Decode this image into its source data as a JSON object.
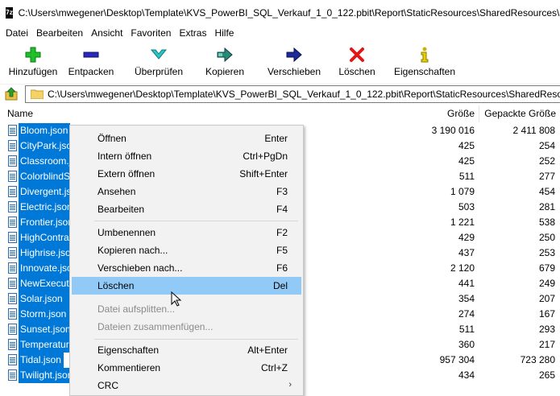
{
  "title": {
    "icon_text": "7z",
    "path": "C:\\Users\\mwegener\\Desktop\\Template\\KVS_PowerBI_SQL_Verkauf_1_0_122.pbit\\Report\\StaticResources\\SharedResources\\Buil"
  },
  "menu": [
    "Datei",
    "Bearbeiten",
    "Ansicht",
    "Favoriten",
    "Extras",
    "Hilfe"
  ],
  "toolbar": {
    "add": "Hinzufügen",
    "extract": "Entpacken",
    "test": "Überprüfen",
    "copy": "Kopieren",
    "move": "Verschieben",
    "delete": "Löschen",
    "info": "Eigenschaften"
  },
  "address": {
    "path": "C:\\Users\\mwegener\\Desktop\\Template\\KVS_PowerBI_SQL_Verkauf_1_0_122.pbit\\Report\\StaticResources\\SharedResources"
  },
  "columns": {
    "name": "Name",
    "size": "Größe",
    "packed": "Gepackte Größe"
  },
  "files": [
    {
      "name": "Bloom.json",
      "size": "3 190 016",
      "packed": "2 411 808"
    },
    {
      "name": "CityPark.json",
      "size": "425",
      "packed": "254"
    },
    {
      "name": "Classroom.json",
      "size": "425",
      "packed": "252"
    },
    {
      "name": "ColorblindSafe",
      "size": "511",
      "packed": "277"
    },
    {
      "name": "Divergent.json",
      "size": "1 079",
      "packed": "454"
    },
    {
      "name": "Electric.json",
      "size": "503",
      "packed": "281"
    },
    {
      "name": "Frontier.json",
      "size": "1 221",
      "packed": "538"
    },
    {
      "name": "HighContrast",
      "size": "429",
      "packed": "250"
    },
    {
      "name": "Highrise.json",
      "size": "437",
      "packed": "253"
    },
    {
      "name": "Innovate.json",
      "size": "2 120",
      "packed": "679"
    },
    {
      "name": "NewExecutive",
      "size": "441",
      "packed": "249"
    },
    {
      "name": "Solar.json",
      "size": "354",
      "packed": "207"
    },
    {
      "name": "Storm.json",
      "size": "274",
      "packed": "167"
    },
    {
      "name": "Sunset.json",
      "size": "511",
      "packed": "293"
    },
    {
      "name": "Temperature",
      "size": "360",
      "packed": "217"
    },
    {
      "name": "Tidal.json",
      "size": "957 304",
      "packed": "723 280"
    },
    {
      "name": "Twilight.json",
      "size": "434",
      "packed": "265"
    }
  ],
  "context_menu": {
    "open": {
      "label": "Öffnen",
      "shortcut": "Enter"
    },
    "open_inside": {
      "label": "Intern öffnen",
      "shortcut": "Ctrl+PgDn"
    },
    "open_outside": {
      "label": "Extern öffnen",
      "shortcut": "Shift+Enter"
    },
    "view": {
      "label": "Ansehen",
      "shortcut": "F3"
    },
    "edit": {
      "label": "Bearbeiten",
      "shortcut": "F4"
    },
    "rename": {
      "label": "Umbenennen",
      "shortcut": "F2"
    },
    "copy_to": {
      "label": "Kopieren nach...",
      "shortcut": "F5"
    },
    "move_to": {
      "label": "Verschieben nach...",
      "shortcut": "F6"
    },
    "delete": {
      "label": "Löschen",
      "shortcut": "Del"
    },
    "split": {
      "label": "Datei aufsplitten..."
    },
    "combine": {
      "label": "Dateien zusammenfügen..."
    },
    "properties": {
      "label": "Eigenschaften",
      "shortcut": "Alt+Enter"
    },
    "comment": {
      "label": "Kommentieren",
      "shortcut": "Ctrl+Z"
    },
    "crc": {
      "label": "CRC"
    }
  },
  "colors": {
    "selection": "#0078d7",
    "menu_highlight": "#91c9f7"
  }
}
